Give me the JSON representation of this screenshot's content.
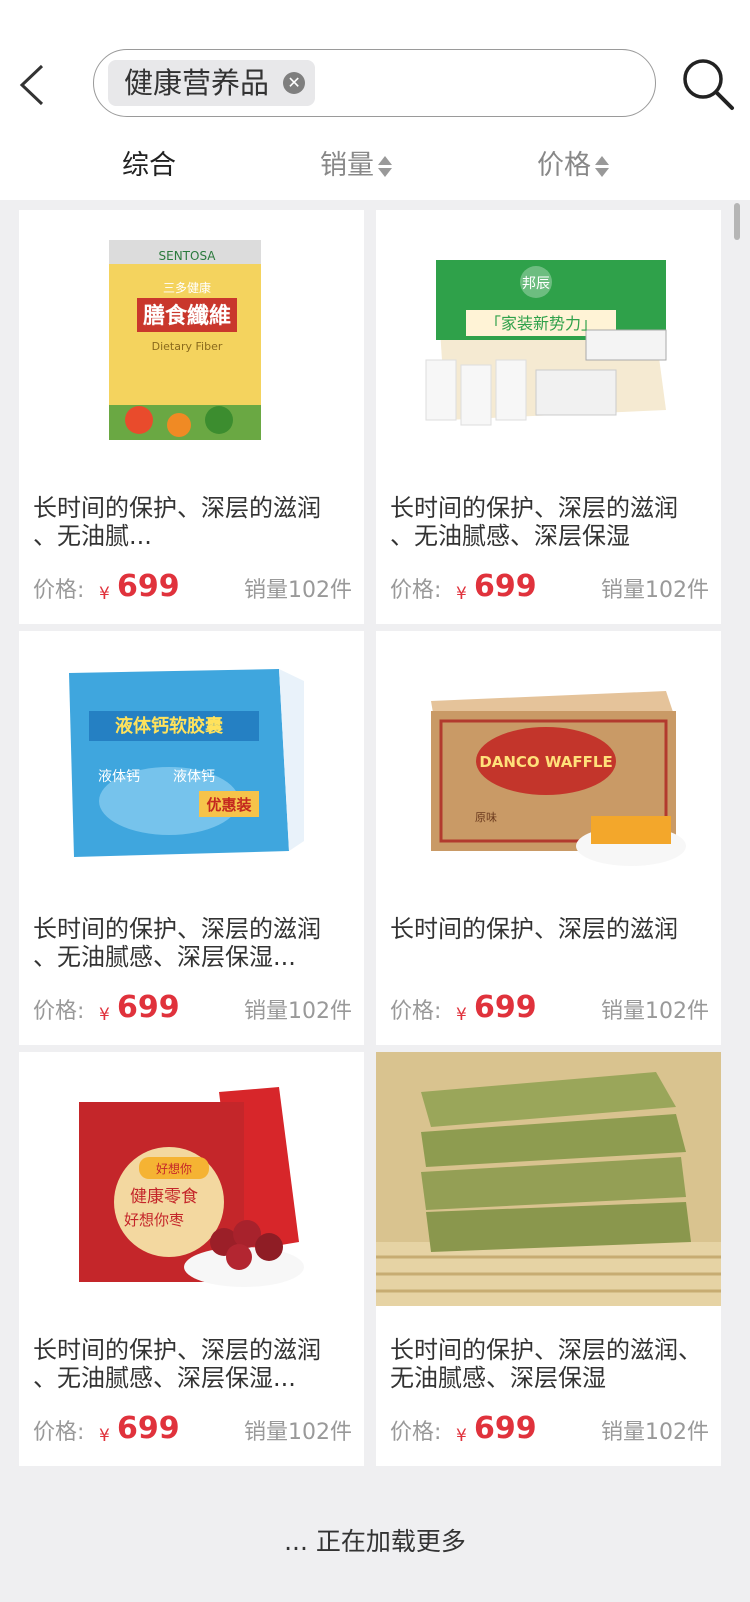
{
  "search": {
    "tag": "健康营养品"
  },
  "tabs": [
    {
      "label": "综合",
      "active": true
    },
    {
      "label": "销量",
      "active": false
    },
    {
      "label": "价格",
      "active": false
    }
  ],
  "products": [
    {
      "title": "长时间的保护、深层的滋润\n、无油腻...",
      "price_label": "价格:",
      "currency": "¥",
      "price": "699",
      "sales": "销量102件",
      "image_text": [
        "SENTOSA",
        "三多健康",
        "膳食纖維",
        "Dietary Fiber"
      ]
    },
    {
      "title": "长时间的保护、深层的滋润\n、无油腻感、深层保湿",
      "price_label": "价格:",
      "currency": "¥",
      "price": "699",
      "sales": "销量102件",
      "image_text": [
        "邦辰",
        "「家装新势力」"
      ]
    },
    {
      "title": "长时间的保护、深层的滋润\n、无油腻感、深层保湿...",
      "price_label": "价格:",
      "currency": "¥",
      "price": "699",
      "sales": "销量102件",
      "image_text": [
        "液体钙软胶囊",
        "液体钙",
        "液体钙",
        "优惠装"
      ]
    },
    {
      "title": "长时间的保护、深层的滋润",
      "price_label": "价格:",
      "currency": "¥",
      "price": "699",
      "sales": "销量102件",
      "image_text": [
        "DANCO WAFFLE",
        "原味"
      ]
    },
    {
      "title": "长时间的保护、深层的滋润\n、无油腻感、深层保湿...",
      "price_label": "价格:",
      "currency": "¥",
      "price": "699",
      "sales": "销量102件",
      "image_text": [
        "好想你",
        "健康零食",
        "好想你枣"
      ]
    },
    {
      "title": "长时间的保护、深层的滋润、\n无油腻感、深层保湿",
      "price_label": "价格:",
      "currency": "¥",
      "price": "699",
      "sales": "销量102件",
      "image_text": []
    }
  ],
  "loading": "... 正在加载更多",
  "colors": {
    "price": "#e0323c",
    "muted": "#999999",
    "background": "#efeff1"
  }
}
